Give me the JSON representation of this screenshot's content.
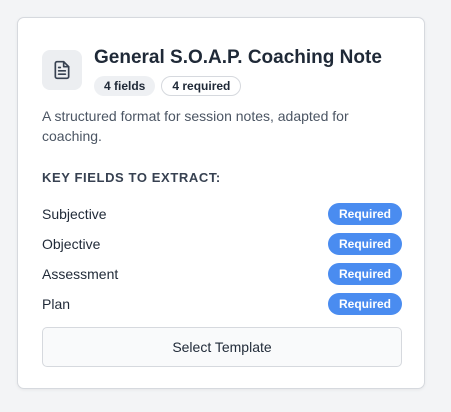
{
  "card": {
    "title": "General S.O.A.P. Coaching Note",
    "badges": {
      "fields": "4 fields",
      "required": "4 required"
    },
    "description": "A structured format for session notes, adapted for coaching.",
    "section_heading": "KEY FIELDS TO EXTRACT:",
    "fields": [
      {
        "name": "Subjective",
        "status": "Required"
      },
      {
        "name": "Objective",
        "status": "Required"
      },
      {
        "name": "Assessment",
        "status": "Required"
      },
      {
        "name": "Plan",
        "status": "Required"
      }
    ],
    "action_label": "Select Template",
    "icon": "document-icon"
  },
  "colors": {
    "accent": "#4a8cf0",
    "card_border": "#d6d9de",
    "page_background": "#f3f4f6"
  }
}
